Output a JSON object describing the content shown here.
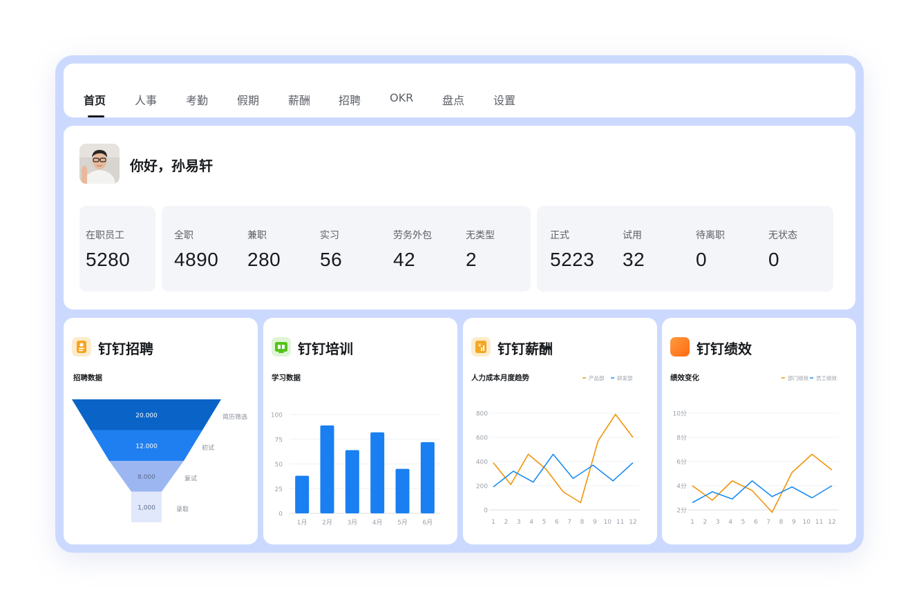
{
  "nav": {
    "tabs": [
      "首页",
      "人事",
      "考勤",
      "假期",
      "薪酬",
      "招聘",
      "OKR",
      "盘点",
      "设置"
    ],
    "active_index": 0
  },
  "welcome": {
    "greeting": "你好，孙易轩"
  },
  "stats": {
    "employees": {
      "label": "在职员工",
      "value": "5280"
    },
    "types": [
      {
        "label": "全职",
        "value": "4890"
      },
      {
        "label": "兼职",
        "value": "280"
      },
      {
        "label": "实习",
        "value": "56"
      },
      {
        "label": "劳务外包",
        "value": "42"
      },
      {
        "label": "无类型",
        "value": "2"
      }
    ],
    "statuses": [
      {
        "label": "正式",
        "value": "5223"
      },
      {
        "label": "试用",
        "value": "32"
      },
      {
        "label": "待离职",
        "value": "0"
      },
      {
        "label": "无状态",
        "value": "0"
      }
    ]
  },
  "modules": [
    {
      "title": "钉钉招聘",
      "icon": "recruit-icon",
      "color": "#f5a623"
    },
    {
      "title": "钉钉培训",
      "icon": "training-icon",
      "color": "#52c41a"
    },
    {
      "title": "钉钉薪酬",
      "icon": "salary-icon",
      "color": "#f5a623"
    },
    {
      "title": "钉钉绩效",
      "icon": "performance-icon",
      "color": "#ff7a1a"
    }
  ],
  "chart_data": [
    {
      "type": "funnel",
      "title": "招聘数据",
      "stages": [
        {
          "name": "简历筛选",
          "label": "20.000",
          "value": 20000,
          "color": "#0a64c8"
        },
        {
          "name": "初试",
          "label": "12.000",
          "value": 12000,
          "color": "#1f7ff0"
        },
        {
          "name": "复试",
          "label": "8.000",
          "value": 8000,
          "color": "#9cb6f2"
        },
        {
          "name": "录取",
          "label": "1,000",
          "value": 1000,
          "color": "#e2e8fb"
        }
      ]
    },
    {
      "type": "bar",
      "title": "学习数据",
      "categories": [
        "1月",
        "2月",
        "3月",
        "4月",
        "5月",
        "6月"
      ],
      "values": [
        38,
        89,
        64,
        82,
        45,
        72
      ],
      "ylim": [
        0,
        100
      ],
      "yticks": [
        0,
        25,
        50,
        75,
        100
      ],
      "color": "#1a7ff0"
    },
    {
      "type": "line",
      "title": "人力成本月度趋势",
      "x": [
        1,
        2,
        3,
        4,
        5,
        6,
        7,
        8,
        9,
        10,
        11,
        12
      ],
      "ylim": [
        0,
        800
      ],
      "yticks": [
        0,
        200,
        400,
        600,
        800
      ],
      "ytick_labels": [
        "0",
        "200",
        "400",
        "600",
        "800"
      ],
      "series": [
        {
          "name": "产品部",
          "color": "#f0940a",
          "values": [
            390,
            210,
            460,
            340,
            150,
            60,
            570,
            790,
            600
          ]
        },
        {
          "name": "研发部",
          "color": "#1a8cf0",
          "values": [
            190,
            320,
            230,
            460,
            260,
            370,
            240,
            390
          ]
        }
      ],
      "series_x": [
        [
          1,
          2,
          3,
          4,
          5,
          6,
          7,
          8,
          9,
          10,
          11,
          12
        ],
        [
          1,
          2,
          3,
          4,
          5,
          6,
          7,
          8,
          9,
          10,
          11,
          12
        ]
      ],
      "legend": "top-right"
    },
    {
      "type": "line",
      "title": "绩效变化",
      "x": [
        1,
        2,
        3,
        4,
        5,
        6,
        7,
        8,
        9,
        10,
        11,
        12
      ],
      "ylim": [
        2,
        10
      ],
      "yticks": [
        2,
        4,
        6,
        8,
        10
      ],
      "ytick_labels": [
        "2分",
        "4分",
        "6分",
        "8分",
        "10分"
      ],
      "series": [
        {
          "name": "部门绩效",
          "color": "#f0940a",
          "values": [
            4,
            2.8,
            4.4,
            3.6,
            1.8,
            5.1,
            6.6,
            5.3
          ]
        },
        {
          "name": "员工绩效",
          "color": "#1a8cf0",
          "values": [
            2.6,
            3.5,
            2.9,
            4.4,
            3.1,
            3.9,
            3,
            4
          ]
        }
      ],
      "legend": "top-right"
    }
  ]
}
